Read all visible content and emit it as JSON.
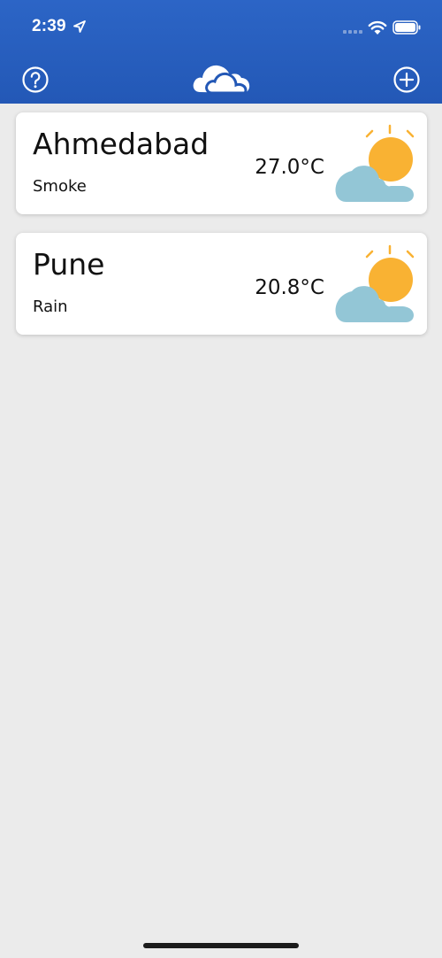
{
  "status": {
    "time": "2:39"
  },
  "header": {
    "help_icon": "help-circle-icon",
    "logo_icon": "cloud-icon",
    "add_icon": "plus-circle-icon"
  },
  "cities": [
    {
      "name": "Ahmedabad",
      "condition": "Smoke",
      "temperature": "27.0°C",
      "icon": "partly-cloudy-icon"
    },
    {
      "name": "Pune",
      "condition": "Rain",
      "temperature": "20.8°C",
      "icon": "partly-cloudy-icon"
    }
  ],
  "colors": {
    "header": "#2358b6",
    "background": "#ebebeb",
    "sun": "#f9b233",
    "cloud": "#93c6d6"
  }
}
